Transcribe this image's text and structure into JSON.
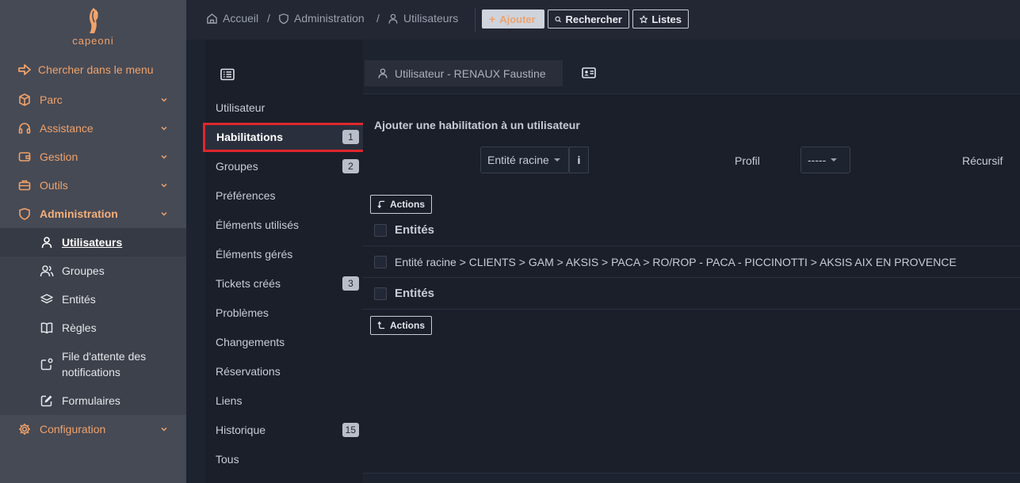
{
  "brand": {
    "name": "capeoni",
    "accent": "#f0a26b"
  },
  "sidebar": {
    "search_label": "Chercher dans le menu",
    "items": [
      {
        "label": "Parc",
        "icon": "box-icon"
      },
      {
        "label": "Assistance",
        "icon": "headset-icon"
      },
      {
        "label": "Gestion",
        "icon": "wallet-icon"
      },
      {
        "label": "Outils",
        "icon": "briefcase-icon"
      },
      {
        "label": "Administration",
        "icon": "shield-icon"
      },
      {
        "label": "Configuration",
        "icon": "gear-icon"
      }
    ],
    "admin_sub": [
      {
        "label": "Utilisateurs",
        "icon": "user-icon"
      },
      {
        "label": "Groupes",
        "icon": "users-icon"
      },
      {
        "label": "Entités",
        "icon": "layers-icon"
      },
      {
        "label": "Règles",
        "icon": "book-icon"
      },
      {
        "label": "File d'attente des notifications",
        "icon": "bell-queue-icon"
      },
      {
        "label": "Formulaires",
        "icon": "edit-icon"
      }
    ]
  },
  "breadcrumb": {
    "home": "Accueil",
    "admin": "Administration",
    "users": "Utilisateurs",
    "sep": "/"
  },
  "toolbar": {
    "add_label": "Ajouter",
    "search_label": "Rechercher",
    "lists_label": "Listes"
  },
  "tabs": [
    {
      "label": "Utilisateur",
      "count": ""
    },
    {
      "label": "Habilitations",
      "count": "1"
    },
    {
      "label": "Groupes",
      "count": "2"
    },
    {
      "label": "Préférences",
      "count": ""
    },
    {
      "label": "Éléments utilisés",
      "count": ""
    },
    {
      "label": "Éléments gérés",
      "count": ""
    },
    {
      "label": "Tickets créés",
      "count": "3"
    },
    {
      "label": "Problèmes",
      "count": ""
    },
    {
      "label": "Changements",
      "count": ""
    },
    {
      "label": "Réservations",
      "count": ""
    },
    {
      "label": "Liens",
      "count": ""
    },
    {
      "label": "Historique",
      "count": "15"
    },
    {
      "label": "Tous",
      "count": ""
    }
  ],
  "main": {
    "header_tab": "Utilisateur - RENAUX Faustine",
    "panel_title": "Ajouter une habilitation à un utilisateur",
    "entity_select": "Entité racine",
    "info_label": "i",
    "profile_label": "Profil",
    "profile_select": "-----",
    "recursive_label": "Récursif",
    "actions_label": "Actions",
    "table_header": "Entités",
    "table_footer": "Entités",
    "rows": [
      "Entité racine > CLIENTS > GAM > AKSIS > PACA > RO/ROP - PACA - PICCINOTTI > AKSIS AIX EN PROVENCE"
    ]
  }
}
